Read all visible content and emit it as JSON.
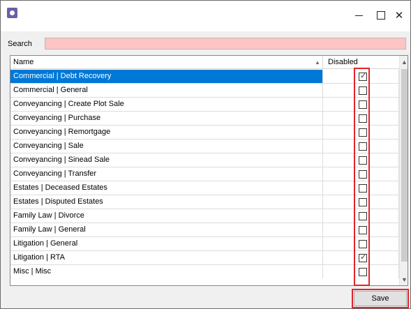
{
  "window": {
    "icon": "app-icon",
    "controls": [
      "minimize-icon",
      "maximize-icon",
      "close-icon"
    ]
  },
  "search": {
    "label": "Search",
    "value": "",
    "placeholder": ""
  },
  "grid": {
    "columns": {
      "name": "Name",
      "disabled": "Disabled"
    },
    "sort_indicator": "▲",
    "rows": [
      {
        "name": "Commercial | Debt Recovery",
        "disabled": true,
        "selected": true
      },
      {
        "name": "Commercial | General",
        "disabled": false
      },
      {
        "name": "Conveyancing | Create Plot Sale",
        "disabled": false
      },
      {
        "name": "Conveyancing | Purchase",
        "disabled": false
      },
      {
        "name": "Conveyancing | Remortgage",
        "disabled": false
      },
      {
        "name": "Conveyancing | Sale",
        "disabled": false
      },
      {
        "name": "Conveyancing | Sinead Sale",
        "disabled": false
      },
      {
        "name": "Conveyancing | Transfer",
        "disabled": false
      },
      {
        "name": "Estates | Deceased Estates",
        "disabled": false
      },
      {
        "name": "Estates | Disputed Estates",
        "disabled": false
      },
      {
        "name": "Family Law | Divorce",
        "disabled": false
      },
      {
        "name": "Family Law | General",
        "disabled": false
      },
      {
        "name": "Litigation | General",
        "disabled": false
      },
      {
        "name": "Litigation | RTA",
        "disabled": true
      },
      {
        "name": "Misc | Misc",
        "disabled": false
      }
    ]
  },
  "actions": {
    "save_label": "Save"
  },
  "colors": {
    "selection": "#0078d7",
    "search_bg": "#ffc4c4",
    "highlight": "#e0242a"
  }
}
